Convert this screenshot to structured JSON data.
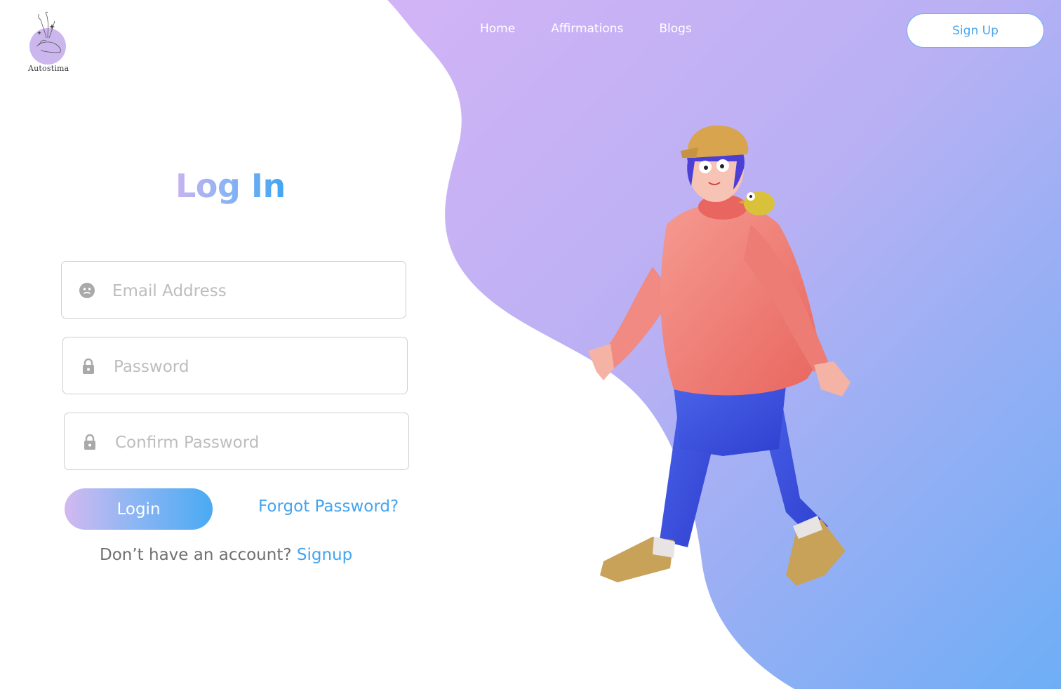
{
  "brand": {
    "logo_text": "Autostima"
  },
  "nav": {
    "items": [
      "Home",
      "Affirmations",
      "Blogs"
    ]
  },
  "header": {
    "signup_button": "Sign Up"
  },
  "form": {
    "title": "Log In",
    "email": {
      "placeholder": "Email Address",
      "icon": "face-icon"
    },
    "password": {
      "placeholder": "Password",
      "icon": "lock-icon"
    },
    "confirm_password": {
      "placeholder": "Confirm Password",
      "icon": "lock-icon"
    },
    "login_button": "Login",
    "forgot_password": "Forgot Password?",
    "no_account_prompt": "Don’t have an account?",
    "signup_link": "Signup"
  },
  "colors": {
    "accent_blue": "#44a4ef",
    "accent_purple": "#c9b3f0",
    "gradient_end": "#6fb0f5"
  }
}
